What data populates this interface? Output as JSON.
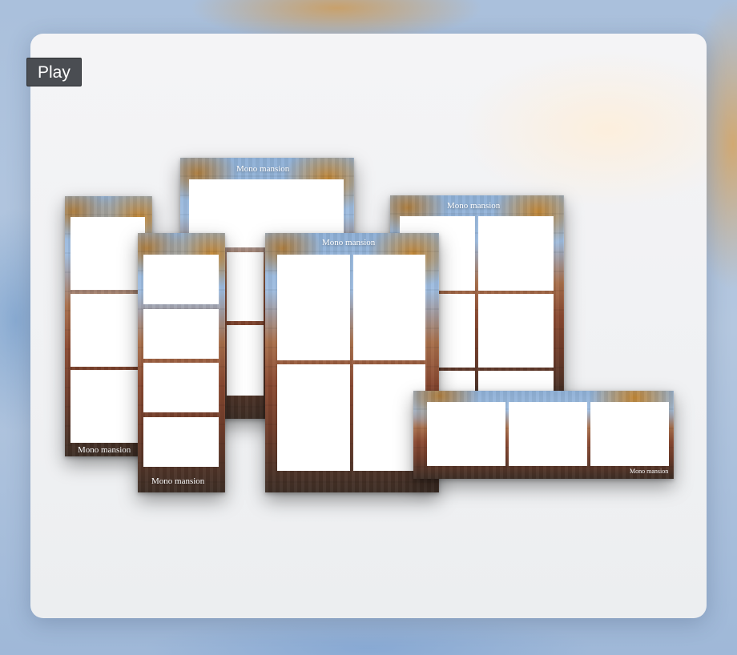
{
  "player": {
    "play_label": "Play"
  },
  "templates": [
    {
      "id": "tall-left",
      "brand": "Mono mansion"
    },
    {
      "id": "tall-center",
      "brand": "Mono mansion"
    },
    {
      "id": "strip-four",
      "brand": "Mono mansion"
    },
    {
      "id": "grid-center",
      "brand": "Mono mansion"
    },
    {
      "id": "grid-right",
      "brand": "Mono mansion"
    },
    {
      "id": "wide-strip",
      "brand": "Mono mansion"
    }
  ],
  "colors": {
    "slot": "#ffffff",
    "play_button": "#4a4d52",
    "card": "#f2f3f5"
  }
}
